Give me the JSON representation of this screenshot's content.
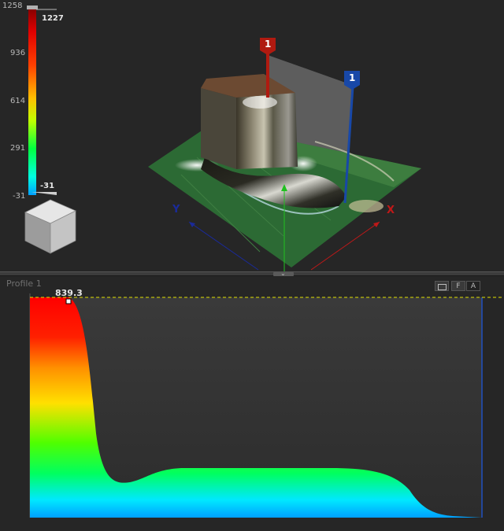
{
  "color_scale": {
    "ticks": [
      "1258",
      "936",
      "614",
      "291",
      "-31"
    ],
    "max_marker": "1227",
    "min_marker": "-31",
    "gradient": [
      "#8b0000",
      "#ff0000",
      "#ff8c00",
      "#ffff00",
      "#00ff00",
      "#00ffff",
      "#0080ff"
    ]
  },
  "view3d": {
    "marker_red_label": "1",
    "marker_blue_label": "1",
    "axis_x_label": "X",
    "axis_y_label": "Y",
    "colors": {
      "x_axis": "#c01818",
      "y_axis": "#1a2a9a",
      "z_axis": "#20c020",
      "marker_red": "#b01a10",
      "marker_blue": "#1848a8"
    }
  },
  "profile_panel": {
    "title": "Profile 1",
    "buttons": [
      "F",
      "A"
    ],
    "peak_label": "839.3"
  }
}
